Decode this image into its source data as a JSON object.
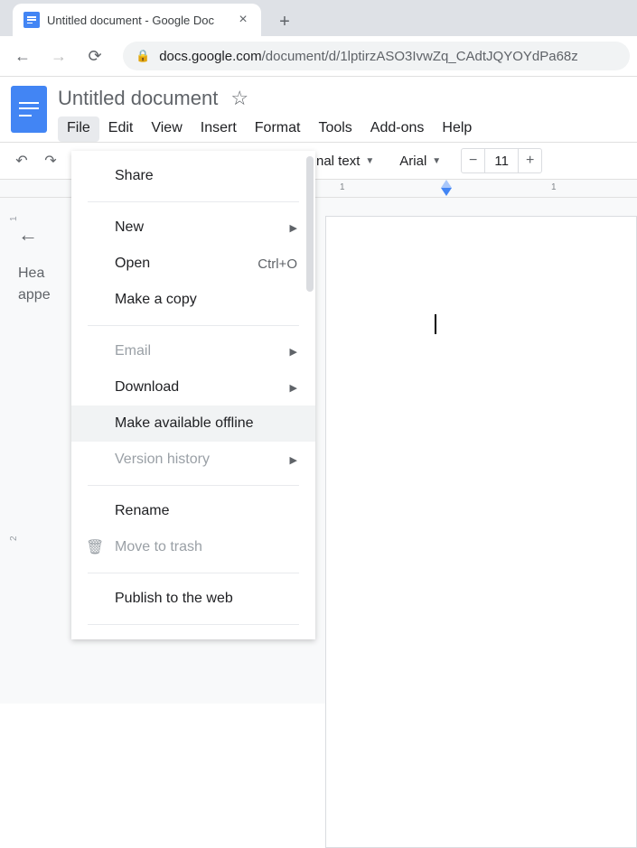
{
  "browser": {
    "tab_title": "Untitled document - Google Doc",
    "url_host": "docs.google.com",
    "url_path": "/document/d/1lptirzASO3IvwZq_CAdtJQYOYdPa68z"
  },
  "doc": {
    "title": "Untitled document"
  },
  "menubar": [
    "File",
    "Edit",
    "View",
    "Insert",
    "Format",
    "Tools",
    "Add-ons",
    "Help"
  ],
  "toolbar": {
    "style_label": "nal text",
    "font_label": "Arial",
    "font_size": "11"
  },
  "ruler": {
    "ticks_left": "1",
    "ticks_right": "1"
  },
  "outline": {
    "line1": "Hea",
    "line2": "appe"
  },
  "file_menu": {
    "share": "Share",
    "new": "New",
    "open": "Open",
    "open_shortcut": "Ctrl+O",
    "make_copy": "Make a copy",
    "email": "Email",
    "download": "Download",
    "make_offline": "Make available offline",
    "version_history": "Version history",
    "rename": "Rename",
    "move_to_trash": "Move to trash",
    "publish": "Publish to the web"
  }
}
